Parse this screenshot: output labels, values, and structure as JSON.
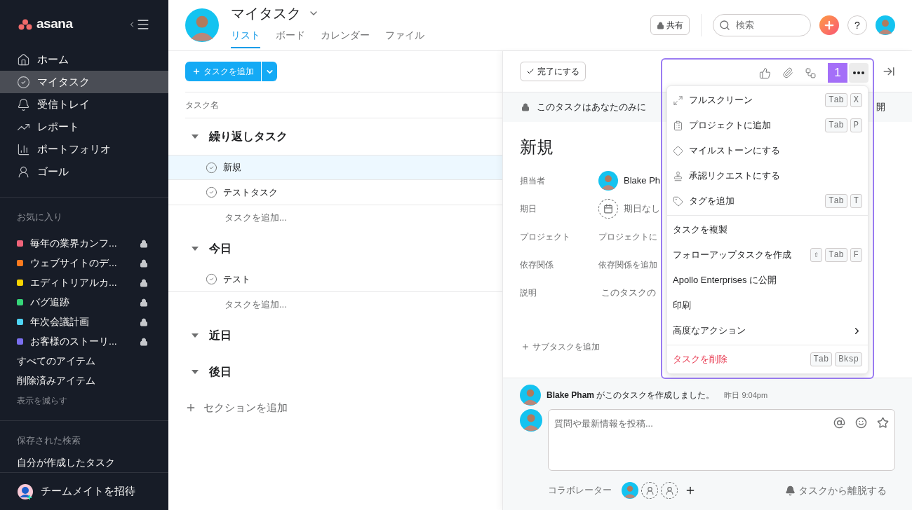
{
  "sidebar": {
    "logo": "asana",
    "nav": [
      {
        "label": "ホーム",
        "selected": false
      },
      {
        "label": "マイタスク",
        "selected": true
      },
      {
        "label": "受信トレイ",
        "selected": false
      },
      {
        "label": "レポート",
        "selected": false
      },
      {
        "label": "ポートフォリオ",
        "selected": false
      },
      {
        "label": "ゴール",
        "selected": false
      }
    ],
    "favorites_heading": "お気に入り",
    "favorites": [
      {
        "label": "毎年の業界カンフ...",
        "color": "#f0647a"
      },
      {
        "label": "ウェブサイトのデ...",
        "color": "#fd7a1e"
      },
      {
        "label": "エディトリアルカ...",
        "color": "#f8d400"
      },
      {
        "label": "バグ追跡",
        "color": "#36d679"
      },
      {
        "label": "年次会議計画",
        "color": "#4ed4f5"
      },
      {
        "label": "お客様のストーリ...",
        "color": "#7a6ff0"
      }
    ],
    "links": [
      "すべてのアイテム",
      "削除済みアイテム"
    ],
    "show_less": "表示を減らす",
    "saved_heading": "保存された検索",
    "saved": [
      "自分が作成したタスク"
    ],
    "invite": "チームメイトを招待"
  },
  "header": {
    "title": "マイタスク",
    "tabs": [
      {
        "label": "リスト",
        "selected": true
      },
      {
        "label": "ボード",
        "selected": false
      },
      {
        "label": "カレンダー",
        "selected": false
      },
      {
        "label": "ファイル",
        "selected": false
      }
    ],
    "share": "共有",
    "search_placeholder": "検索",
    "help": "?"
  },
  "list": {
    "add_task": "タスクを追加",
    "column": "タスク名",
    "sections": [
      {
        "title": "繰り返しタスク",
        "tasks": [
          {
            "name": "新規",
            "selected": true
          },
          {
            "name": "テストタスク",
            "selected": false
          }
        ],
        "add_task": "タスクを追加..."
      },
      {
        "title": "今日",
        "tasks": [
          {
            "name": "テスト",
            "selected": false
          }
        ],
        "add_task": "タスクを追加..."
      },
      {
        "title": "近日"
      },
      {
        "title": "後日"
      }
    ],
    "add_section": "セクションを追加"
  },
  "detail": {
    "complete": "完了にする",
    "badge": "1",
    "banner": "このタスクはあなたのみに",
    "banner_right": "開",
    "title": "新規",
    "fields": [
      {
        "label": "担当者",
        "value": "Blake Ph",
        "kind": "person"
      },
      {
        "label": "期日",
        "value": "期日なし",
        "kind": "date"
      },
      {
        "label": "プロジェクト",
        "value": "プロジェクトに",
        "kind": "link"
      },
      {
        "label": "依存関係",
        "value": "依存関係を追加",
        "kind": "link"
      },
      {
        "label": "説明",
        "value": "このタスクの",
        "kind": "text"
      }
    ],
    "add_subtask": "サブタスクを追加",
    "activity": {
      "author": "Blake Pham",
      "text": "がこのタスクを作成しました。",
      "time": "昨日 9:04pm"
    },
    "composer_placeholder": "質問や最新情報を投稿...",
    "collaborators": "コラボレーター",
    "leave": "タスクから離脱する"
  },
  "menu": [
    [
      {
        "label": "フルスクリーン",
        "kind": "icon",
        "shortcut": [
          "Tab",
          "X"
        ]
      },
      {
        "label": "プロジェクトに追加",
        "kind": "icon",
        "shortcut": [
          "Tab",
          "P"
        ]
      },
      {
        "label": "マイルストーンにする",
        "kind": "icon"
      },
      {
        "label": "承認リクエストにする",
        "kind": "icon"
      },
      {
        "label": "タグを追加",
        "kind": "icon",
        "shortcut": [
          "Tab",
          "T"
        ]
      }
    ],
    [
      {
        "label": "タスクを複製",
        "kind": "plain"
      },
      {
        "label": "フォローアップタスクを作成",
        "kind": "plain",
        "shortcut": [
          "⇧",
          "Tab",
          "F"
        ]
      },
      {
        "label": "Apollo Enterprises に公開",
        "kind": "plain"
      },
      {
        "label": "印刷",
        "kind": "plain"
      },
      {
        "label": "高度なアクション",
        "kind": "submenu"
      }
    ],
    [
      {
        "label": "タスクを削除",
        "kind": "danger",
        "shortcut": [
          "Tab",
          "Bksp"
        ]
      }
    ]
  ]
}
